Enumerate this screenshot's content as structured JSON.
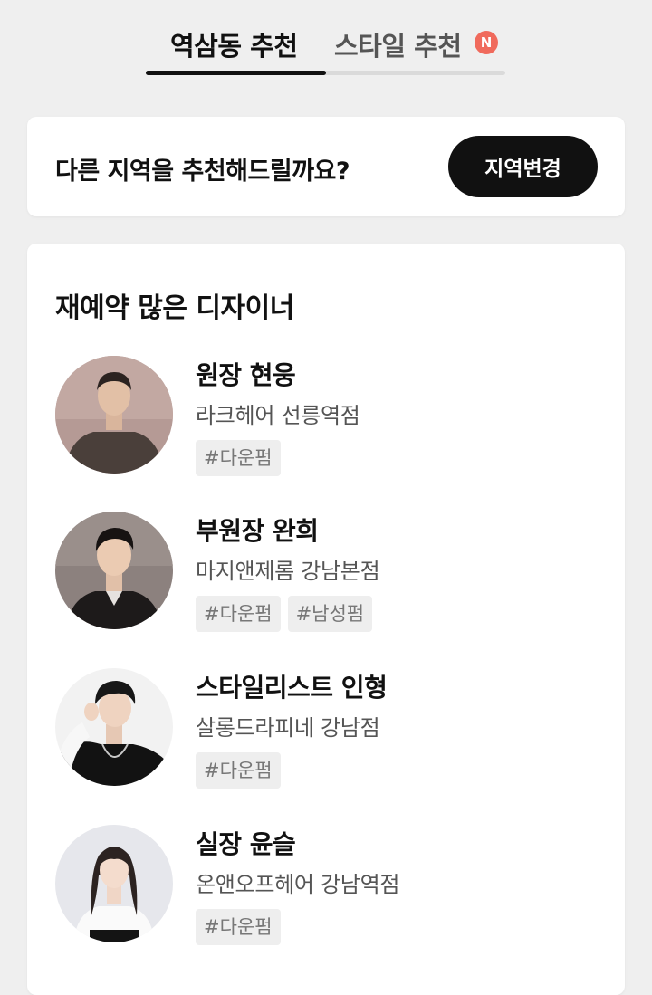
{
  "tabs": [
    {
      "label": "역삼동 추천",
      "active": true
    },
    {
      "label": "스타일 추천",
      "active": false,
      "badge": "N"
    }
  ],
  "colors": {
    "accent": "#111111",
    "badge": "#f06a5c",
    "background": "#efefef"
  },
  "region": {
    "prompt": "다른 지역을 추천해드릴까요?",
    "button_label": "지역변경"
  },
  "designers_section": {
    "title": "재예약 많은 디자이너",
    "designers": [
      {
        "name": "원장 현웅",
        "salon": "라크헤어 선릉역점",
        "tags": [
          "#다운펌"
        ],
        "avatar": "avatar-photo"
      },
      {
        "name": "부원장 완희",
        "salon": "마지앤제롬 강남본점",
        "tags": [
          "#다운펌",
          "#남성펌"
        ],
        "avatar": "avatar-photo"
      },
      {
        "name": "스타일리스트 인형",
        "salon": "살롱드라피네 강남점",
        "tags": [
          "#다운펌"
        ],
        "avatar": "avatar-photo"
      },
      {
        "name": "실장 윤슬",
        "salon": "온앤오프헤어 강남역점",
        "tags": [
          "#다운펌"
        ],
        "avatar": "avatar-photo"
      }
    ]
  }
}
